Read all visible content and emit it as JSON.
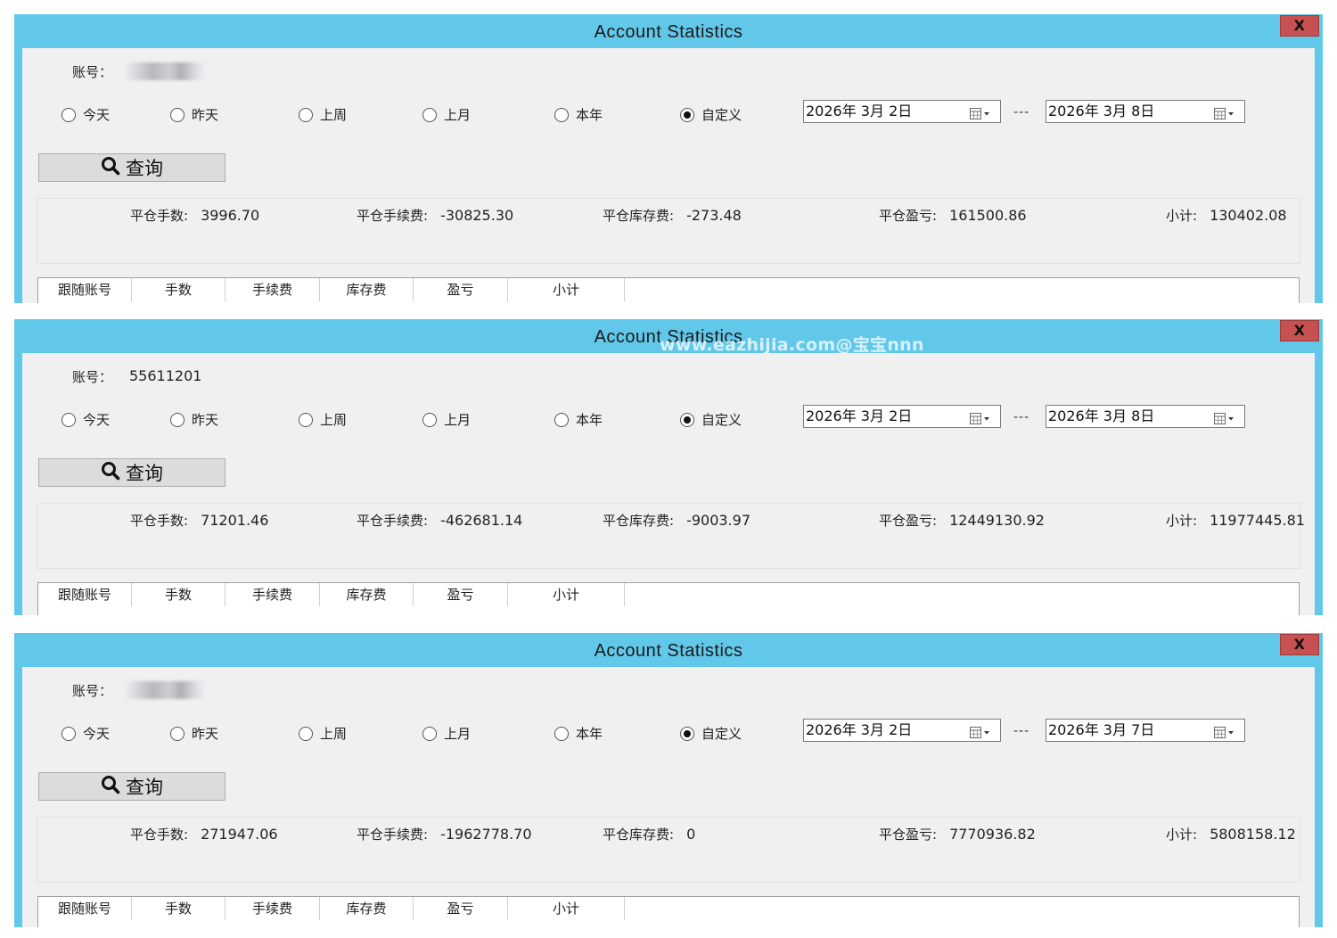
{
  "windows": [
    {
      "title": "Account Statistics",
      "close_label": "X",
      "account_label": "账号：",
      "account_value": "",
      "account_blurred": true,
      "radios": [
        {
          "label": "今天",
          "selected": false
        },
        {
          "label": "昨天",
          "selected": false
        },
        {
          "label": "上周",
          "selected": false
        },
        {
          "label": "上月",
          "selected": false
        },
        {
          "label": "本年",
          "selected": false
        },
        {
          "label": "自定义",
          "selected": true
        }
      ],
      "date_from": "2026年  3月  2日",
      "date_sep": "---",
      "date_to": "2026年  3月  8日",
      "query_label": "查询",
      "stats": [
        {
          "label": "平仓手数:",
          "value": "3996.70"
        },
        {
          "label": "平仓手续费:",
          "value": "-30825.30"
        },
        {
          "label": "平仓库存费:",
          "value": "-273.48"
        },
        {
          "label": "平仓盈亏:",
          "value": "161500.86"
        },
        {
          "label": "小计:",
          "value": "130402.08"
        }
      ],
      "columns": [
        "跟随账号",
        "手数",
        "手续费",
        "库存费",
        "盈亏",
        "小计"
      ]
    },
    {
      "title": "Account Statistics",
      "close_label": "X",
      "account_label": "账号：",
      "account_value": "55611201",
      "account_blurred": false,
      "radios": [
        {
          "label": "今天",
          "selected": false
        },
        {
          "label": "昨天",
          "selected": false
        },
        {
          "label": "上周",
          "selected": false
        },
        {
          "label": "上月",
          "selected": false
        },
        {
          "label": "本年",
          "selected": false
        },
        {
          "label": "自定义",
          "selected": true
        }
      ],
      "date_from": "2026年  3月  2日",
      "date_sep": "---",
      "date_to": "2026年  3月  8日",
      "query_label": "查询",
      "stats": [
        {
          "label": "平仓手数:",
          "value": "71201.46"
        },
        {
          "label": "平仓手续费:",
          "value": "-462681.14"
        },
        {
          "label": "平仓库存费:",
          "value": "-9003.97"
        },
        {
          "label": "平仓盈亏:",
          "value": "12449130.92"
        },
        {
          "label": "小计:",
          "value": "11977445.81"
        }
      ],
      "columns": [
        "跟随账号",
        "手数",
        "手续费",
        "库存费",
        "盈亏",
        "小计"
      ]
    },
    {
      "title": "Account Statistics",
      "close_label": "X",
      "account_label": "账号：",
      "account_value": "",
      "account_blurred": true,
      "radios": [
        {
          "label": "今天",
          "selected": false
        },
        {
          "label": "昨天",
          "selected": false
        },
        {
          "label": "上周",
          "selected": false
        },
        {
          "label": "上月",
          "selected": false
        },
        {
          "label": "本年",
          "selected": false
        },
        {
          "label": "自定义",
          "selected": true
        }
      ],
      "date_from": "2026年  3月  2日",
      "date_sep": "---",
      "date_to": "2026年  3月  7日",
      "query_label": "查询",
      "stats": [
        {
          "label": "平仓手数:",
          "value": "271947.06"
        },
        {
          "label": "平仓手续费:",
          "value": "-1962778.70"
        },
        {
          "label": "平仓库存费:",
          "value": "0"
        },
        {
          "label": "平仓盈亏:",
          "value": "7770936.82"
        },
        {
          "label": "小计:",
          "value": "5808158.12"
        }
      ],
      "columns": [
        "跟随账号",
        "手数",
        "手续费",
        "库存费",
        "盈亏",
        "小计"
      ]
    }
  ],
  "watermark": "www.eazhijia.com@宝宝nnn"
}
